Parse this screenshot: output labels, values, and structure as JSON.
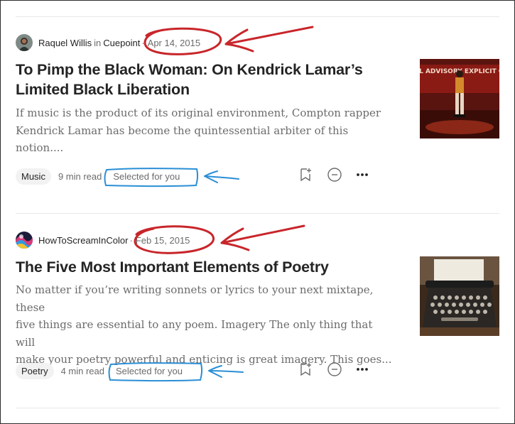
{
  "articles": [
    {
      "author": "Raquel Willis",
      "in_text": "in",
      "publication": "Cuepoint",
      "separator": "·",
      "date": "Apr 14, 2015",
      "title_line1": "To Pimp the Black Woman: On Kendrick Lamar’s",
      "title_line2": "Limited Black Liberation",
      "excerpt_line1": "If music is the product of its original environment, Compton rapper",
      "excerpt_line2": "Kendrick Lamar has become the quintessential arbiter of this notion....",
      "tag": "Music",
      "read_time": "9 min read",
      "selected": "Selected for you",
      "thumb_text": "PARENTAL ADVISORY EXPLICIT CONTENT"
    },
    {
      "author": "HowToScreamInColor",
      "separator": "·",
      "date": "Feb 15, 2015",
      "title_line1": "The Five Most Important Elements of Poetry",
      "excerpt_line1": "No matter if you’re writing sonnets or lyrics to your next mixtape, these",
      "excerpt_line2": "five things are essential to any poem. Imagery The only thing that will",
      "excerpt_line3": "make your poetry powerful and enticing is great imagery. This goes...",
      "tag": "Poetry",
      "read_time": "4 min read",
      "selected": "Selected for you"
    }
  ],
  "colors": {
    "annotation_red": "#c8262b",
    "annotation_blue": "#2a8ed6",
    "text_primary": "#242424",
    "text_muted": "#6b6b6b",
    "tag_bg": "#f2f2f2"
  },
  "icons": [
    "bookmark-add-icon",
    "show-less-icon",
    "more-options-icon"
  ]
}
